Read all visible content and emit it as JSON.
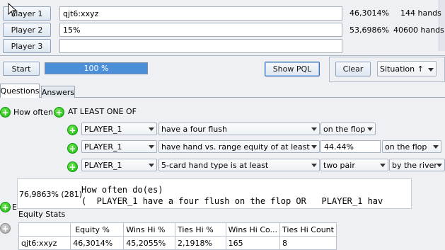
{
  "players": [
    {
      "label": "Player 1",
      "range": "qjt6:xxyz",
      "equity": "46,3014%",
      "hands": "144 hands"
    },
    {
      "label": "Player 2",
      "range": "15%",
      "equity": "53,6986%",
      "hands": "40600 hands"
    },
    {
      "label": "Player 3",
      "range": "",
      "equity": "",
      "hands": ""
    }
  ],
  "controls": {
    "start_label": "Start",
    "progress_text": "100 %",
    "progress_value": 1.0,
    "show_pql_label": "Show PQL",
    "clear_label": "Clear",
    "situation_label": "Situation ↑"
  },
  "tabs": [
    "Questions",
    "Answers"
  ],
  "query": {
    "how_often_label": "How often",
    "at_least_label": "AT LEAST ONE OF",
    "rows": [
      {
        "player": "PLAYER_1",
        "condition": "have a four flush",
        "value": "",
        "street": "on the flop"
      },
      {
        "player": "PLAYER_1",
        "condition": "have hand vs. range equity of at least",
        "value": "44.44%",
        "street": "on the flop"
      },
      {
        "player": "PLAYER_1",
        "condition": "5-card hand type is at least",
        "value": "two pair",
        "street": "by the river"
      }
    ]
  },
  "result_popup": {
    "result": "76,9863% (281)",
    "line1": "How often do(es)",
    "line2": "(  PLAYER_1 have a four flush on the flop OR   PLAYER_1 hav"
  },
  "equity_stats": {
    "title": "Equity Stats",
    "columns": [
      "",
      "Equity %",
      "Wins Hi %",
      "Ties Hi %",
      "Wins Hi Co...",
      "Ties Hi Count"
    ],
    "rows": [
      [
        "qjt6:xxyz",
        "46,3014%",
        "45,2055%",
        "2,1918%",
        "165",
        "8"
      ]
    ]
  },
  "hidden_label_fragment": "E"
}
